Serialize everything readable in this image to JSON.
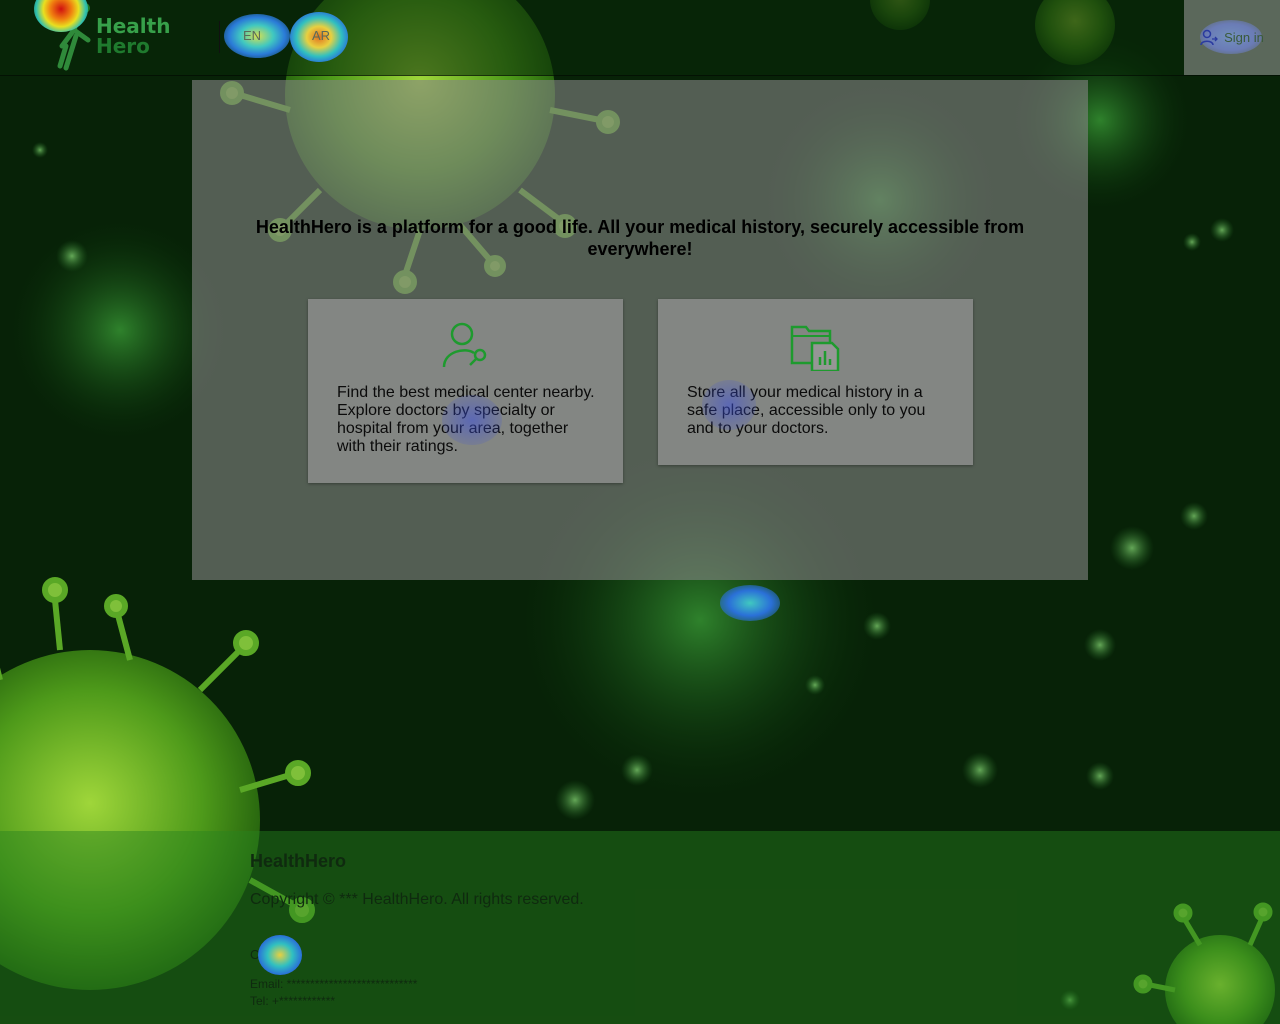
{
  "header": {
    "logo_line1": "Health",
    "logo_line2": "Hero",
    "lang_en": "EN",
    "lang_ar": "AR",
    "signin_label": "Sign in"
  },
  "hero": {
    "tagline": "HealthHero is a platform for a good life. All your medical history, securely accessible from everywhere!",
    "cards": [
      {
        "icon": "doctor-search-icon",
        "text": "Find the best medical center nearby. Explore doctors by specialty or hospital from your area, together with their ratings."
      },
      {
        "icon": "medical-records-folder-icon",
        "text": "Store all your medical history in a safe place, accessible only to you and to your doctors."
      }
    ]
  },
  "footer": {
    "brand": "HealthHero",
    "copyright": "Copyright © *** HealthHero. All rights reserved.",
    "contacts_heading": "Contacts",
    "email": "Email: ****************************",
    "tel": "Tel: +************"
  },
  "colors": {
    "accent_green": "#1e9a2e",
    "dark_green": "#0f2a0f"
  }
}
